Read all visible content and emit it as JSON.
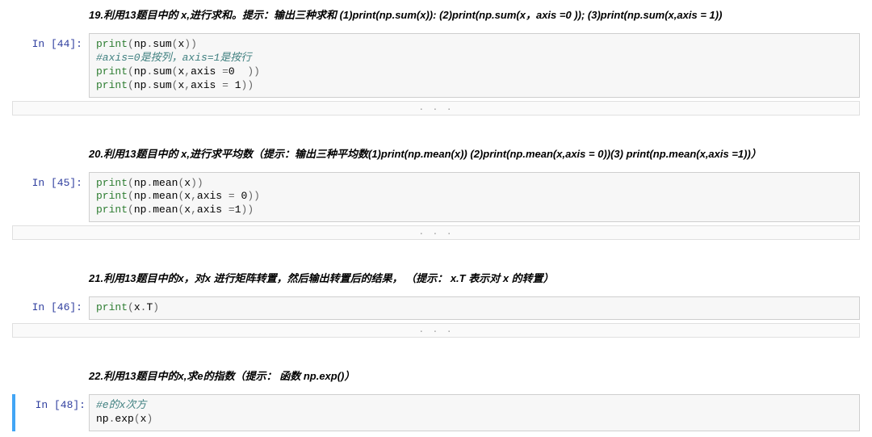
{
  "cells": [
    {
      "type": "heading",
      "text": "19.利用13题目中的 x,进行求和。提示：输出三种求和 (1)print(np.sum(x)): (2)print(np.sum(x，axis =0 )); (3)print(np.sum(x,axis = 1))"
    },
    {
      "type": "code",
      "prompt": "In [44]:",
      "selected": false,
      "lines": [
        {
          "segments": [
            {
              "t": "fn",
              "v": "print"
            },
            {
              "t": "op",
              "v": "("
            },
            {
              "t": "var",
              "v": "np"
            },
            {
              "t": "dot",
              "v": "."
            },
            {
              "t": "var",
              "v": "sum"
            },
            {
              "t": "op",
              "v": "("
            },
            {
              "t": "var",
              "v": "x"
            },
            {
              "t": "op",
              "v": "))"
            }
          ]
        },
        {
          "segments": [
            {
              "t": "comment",
              "v": "#axis=0是按列，axis=1是按行"
            }
          ]
        },
        {
          "segments": [
            {
              "t": "fn",
              "v": "print"
            },
            {
              "t": "op",
              "v": "("
            },
            {
              "t": "var",
              "v": "np"
            },
            {
              "t": "dot",
              "v": "."
            },
            {
              "t": "var",
              "v": "sum"
            },
            {
              "t": "op",
              "v": "("
            },
            {
              "t": "var",
              "v": "x"
            },
            {
              "t": "op",
              "v": ","
            },
            {
              "t": "var",
              "v": "axis "
            },
            {
              "t": "op",
              "v": "="
            },
            {
              "t": "num",
              "v": "0 "
            },
            {
              "t": "op",
              "v": " ))"
            }
          ]
        },
        {
          "segments": [
            {
              "t": "fn",
              "v": "print"
            },
            {
              "t": "op",
              "v": "("
            },
            {
              "t": "var",
              "v": "np"
            },
            {
              "t": "dot",
              "v": "."
            },
            {
              "t": "var",
              "v": "sum"
            },
            {
              "t": "op",
              "v": "("
            },
            {
              "t": "var",
              "v": "x"
            },
            {
              "t": "op",
              "v": ","
            },
            {
              "t": "var",
              "v": "axis "
            },
            {
              "t": "op",
              "v": "= "
            },
            {
              "t": "num",
              "v": "1"
            },
            {
              "t": "op",
              "v": "))"
            }
          ]
        }
      ]
    },
    {
      "type": "collapse",
      "dots": ". . ."
    },
    {
      "type": "spacer"
    },
    {
      "type": "heading",
      "text": "20.利用13题目中的 x,进行求平均数（提示：输出三种平均数(1)print(np.mean(x)) (2)print(np.mean(x,axis = 0))(3) print(np.mean(x,axis =1))）"
    },
    {
      "type": "code",
      "prompt": "In [45]:",
      "selected": false,
      "lines": [
        {
          "segments": [
            {
              "t": "fn",
              "v": "print"
            },
            {
              "t": "op",
              "v": "("
            },
            {
              "t": "var",
              "v": "np"
            },
            {
              "t": "dot",
              "v": "."
            },
            {
              "t": "var",
              "v": "mean"
            },
            {
              "t": "op",
              "v": "("
            },
            {
              "t": "var",
              "v": "x"
            },
            {
              "t": "op",
              "v": "))"
            }
          ]
        },
        {
          "segments": [
            {
              "t": "fn",
              "v": "print"
            },
            {
              "t": "op",
              "v": "("
            },
            {
              "t": "var",
              "v": "np"
            },
            {
              "t": "dot",
              "v": "."
            },
            {
              "t": "var",
              "v": "mean"
            },
            {
              "t": "op",
              "v": "("
            },
            {
              "t": "var",
              "v": "x"
            },
            {
              "t": "op",
              "v": ","
            },
            {
              "t": "var",
              "v": "axis "
            },
            {
              "t": "op",
              "v": "= "
            },
            {
              "t": "num",
              "v": "0"
            },
            {
              "t": "op",
              "v": "))"
            }
          ]
        },
        {
          "segments": [
            {
              "t": "fn",
              "v": "print"
            },
            {
              "t": "op",
              "v": "("
            },
            {
              "t": "var",
              "v": "np"
            },
            {
              "t": "dot",
              "v": "."
            },
            {
              "t": "var",
              "v": "mean"
            },
            {
              "t": "op",
              "v": "("
            },
            {
              "t": "var",
              "v": "x"
            },
            {
              "t": "op",
              "v": ","
            },
            {
              "t": "var",
              "v": "axis "
            },
            {
              "t": "op",
              "v": "="
            },
            {
              "t": "num",
              "v": "1"
            },
            {
              "t": "op",
              "v": "))"
            }
          ]
        }
      ]
    },
    {
      "type": "collapse",
      "dots": ". . ."
    },
    {
      "type": "spacer"
    },
    {
      "type": "heading",
      "text": "21.利用13题目中的x，对x 进行矩阵转置，然后输出转置后的结果， （提示： x.T 表示对 x 的转置）"
    },
    {
      "type": "code",
      "prompt": "In [46]:",
      "selected": false,
      "lines": [
        {
          "segments": [
            {
              "t": "fn",
              "v": "print"
            },
            {
              "t": "op",
              "v": "("
            },
            {
              "t": "var",
              "v": "x"
            },
            {
              "t": "dot",
              "v": "."
            },
            {
              "t": "var",
              "v": "T"
            },
            {
              "t": "op",
              "v": ")"
            }
          ]
        }
      ]
    },
    {
      "type": "collapse",
      "dots": ". . ."
    },
    {
      "type": "spacer"
    },
    {
      "type": "heading",
      "text": "22.利用13题目中的x,求e的指数（提示： 函数 np.exp()）"
    },
    {
      "type": "code",
      "prompt": "In [48]:",
      "selected": true,
      "lines": [
        {
          "segments": [
            {
              "t": "comment",
              "v": "#e的x次方"
            }
          ]
        },
        {
          "segments": [
            {
              "t": "var",
              "v": "np"
            },
            {
              "t": "dot",
              "v": "."
            },
            {
              "t": "var",
              "v": "exp"
            },
            {
              "t": "op",
              "v": "("
            },
            {
              "t": "var",
              "v": "x"
            },
            {
              "t": "op",
              "v": ")"
            }
          ]
        }
      ]
    }
  ]
}
